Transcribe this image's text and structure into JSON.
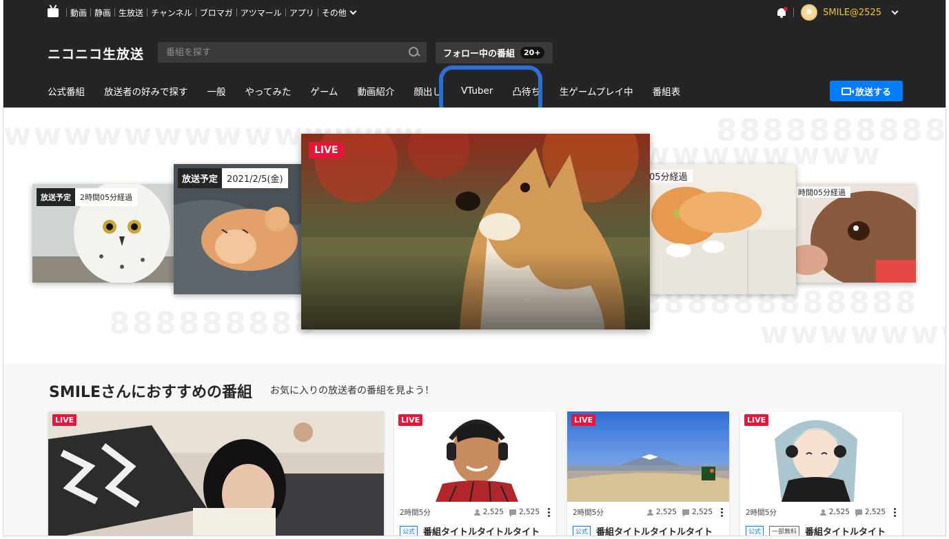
{
  "topbar": {
    "links": [
      "動画",
      "静画",
      "生放送",
      "チャンネル",
      "ブロマガ",
      "アツマール",
      "アプリ",
      "その他"
    ]
  },
  "user": {
    "name": "SMILE@2525"
  },
  "header": {
    "logo": "ニコニコ生放送",
    "search_placeholder": "番組を探す",
    "follow_label": "フォロー中の番組",
    "follow_count": "20+",
    "broadcast_label": "放送する"
  },
  "nav": {
    "items": [
      "公式番組",
      "放送者の好みで探す",
      "一般",
      "やってみた",
      "ゲーム",
      "動画紹介",
      "顔出し",
      "VTuber",
      "凸待ち",
      "生ゲームプレイ中",
      "番組表"
    ]
  },
  "hero": {
    "decor": [
      "wwwwwwwwwwwwww",
      "8888888888",
      "wwwwwwww",
      "888888888",
      "888888888888",
      "wwwwwwww"
    ],
    "cards": [
      {
        "tag": "放送予定",
        "time": "2時間05分経過"
      },
      {
        "tag": "放送予定",
        "time": "2021/2/5(金)"
      },
      {
        "live": "LIVE"
      },
      {
        "time": "05分経過"
      },
      {
        "time": "時間05分経過"
      }
    ]
  },
  "recommend": {
    "title": "SMILEさんにおすすめの番組",
    "subtitle": "お気に入りの放送者の番組を見よう！",
    "live_label": "LIVE",
    "cards": [
      {
        "duration": "",
        "viewers": "",
        "comments": "",
        "badges": [],
        "title": ""
      },
      {
        "duration": "2時間5分",
        "viewers": "2,525",
        "comments": "2,525",
        "badges": [
          "公式"
        ],
        "title": "番組タイトルタイトルタイト"
      },
      {
        "duration": "2時間5分",
        "viewers": "2,525",
        "comments": "2,525",
        "badges": [
          "公式"
        ],
        "title": "番組タイトルタイトルタイト"
      },
      {
        "duration": "2時間5分",
        "viewers": "2,525",
        "comments": "2,525",
        "badges": [
          "公式",
          "一部無料"
        ],
        "title": "番組タイトルタイト"
      }
    ]
  },
  "colors": {
    "header_bg": "#252525",
    "accent_blue": "#007cff",
    "live_red": "#e5153b",
    "username_gold": "#f0c32b",
    "highlight_ring": "#2d6fd8"
  }
}
